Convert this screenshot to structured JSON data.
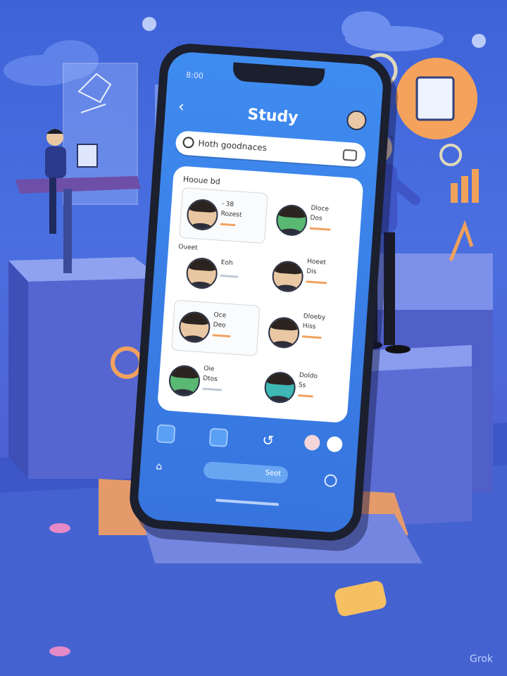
{
  "app": {
    "status_text": "8:00",
    "title": "Study",
    "search_placeholder": "Hoth goodnaces",
    "card_title": "Hooue bd",
    "contacts": [
      {
        "name": "- 38",
        "sub": "Rozest",
        "tone": "dark"
      },
      {
        "name": "Dloce",
        "sub": "Dos",
        "tone": "green"
      },
      {
        "name": "Oueet",
        "sub": "Eoh",
        "tone": "dark"
      },
      {
        "name": "Hoeet",
        "sub": "Dis",
        "tone": "dark"
      },
      {
        "name": "Oce",
        "sub": "Deo",
        "tone": "dark"
      },
      {
        "name": "Dloeby",
        "sub": "Hiss",
        "tone": "dark"
      },
      {
        "name": "Oie",
        "sub": "Dtos",
        "tone": "green"
      },
      {
        "name": "Doldo",
        "sub": "Ss",
        "tone": "teal"
      }
    ],
    "tab_label": "Seot"
  },
  "watermark": "Grok",
  "colors": {
    "accent": "#3f8cf0",
    "orange": "#f0a25a",
    "bg": "#4a6fe0"
  }
}
